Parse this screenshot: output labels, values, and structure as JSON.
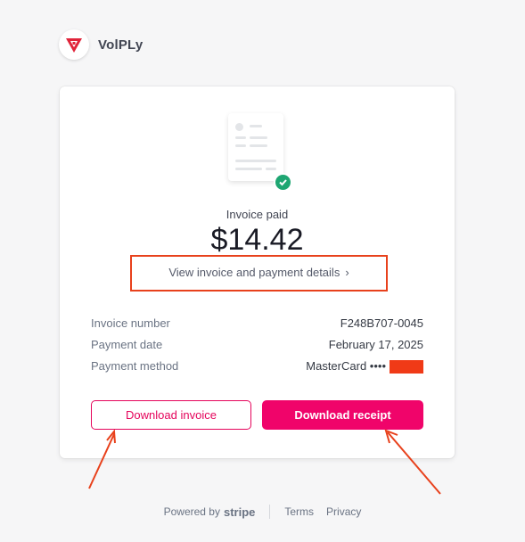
{
  "brand": {
    "name": "VolPLy",
    "logo_icon": "shield-logo-icon"
  },
  "invoice": {
    "status": "Invoice paid",
    "amount": "$14.42",
    "details_link": "View invoice and payment details",
    "rows": [
      {
        "label": "Invoice number",
        "value": "F248B707-0045"
      },
      {
        "label": "Payment date",
        "value": "February 17, 2025"
      },
      {
        "label": "Payment method",
        "value": "MasterCard ••••"
      }
    ]
  },
  "buttons": {
    "download_invoice": "Download invoice",
    "download_receipt": "Download receipt"
  },
  "footer": {
    "powered_by": "Powered by",
    "stripe": "stripe",
    "terms": "Terms",
    "privacy": "Privacy"
  },
  "colors": {
    "accent": "#f0046a",
    "success": "#1ea672",
    "annotation": "#e8411c"
  }
}
